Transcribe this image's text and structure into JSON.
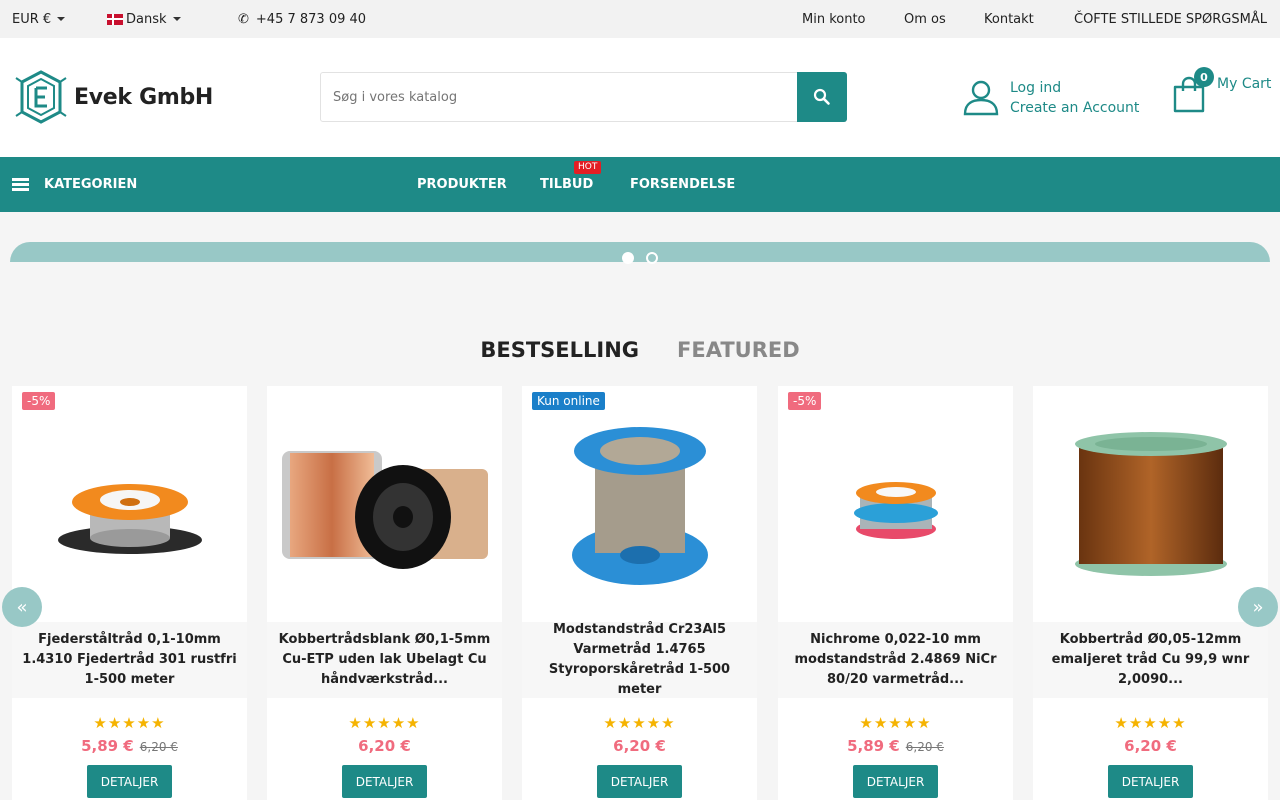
{
  "topbar": {
    "currency": "EUR €",
    "language": "Dansk",
    "phone_icon": "phone-icon",
    "phone": "+45 7 873 09 40",
    "links": [
      "Min konto",
      "Om os",
      "Kontakt",
      "ČOFTE STILLEDE SPØRGSMÅL"
    ]
  },
  "header": {
    "logo_text": "Evek GmbH",
    "search_placeholder": "Søg i vores katalog",
    "login": "Log ind",
    "create_account": "Create an Account",
    "cart_count": "0",
    "cart_label": "My Cart"
  },
  "nav": {
    "categories": "KATEGORIEN",
    "items": [
      "PRODUKTER",
      "TILBUD",
      "FORSENDELSE"
    ],
    "hot_badge": "HOT"
  },
  "tabs": [
    "BESTSELLING",
    "FEATURED"
  ],
  "products": [
    {
      "badge": "-5%",
      "title": "Fjederståltråd 0,1-10mm 1.4310 Fjedertråd 301 rustfri 1-500 meter",
      "price": "5,89 €",
      "old_price": "6,20 €",
      "stars": "★★★★★",
      "button": "DETALJER"
    },
    {
      "badge": "",
      "title": "Kobbertrådsblank Ø0,1-5mm Cu-ETP uden lak Ubelagt Cu håndværkstråd...",
      "price": "6,20 €",
      "old_price": "",
      "stars": "★★★★★",
      "button": "DETALJER"
    },
    {
      "badge": "Kun online",
      "title": "Modstandstråd Cr23Al5 Varmetråd 1.4765 Styroporskåretråd 1-500 meter",
      "price": "6,20 €",
      "old_price": "",
      "stars": "★★★★★",
      "button": "DETALJER"
    },
    {
      "badge": "-5%",
      "title": "Nichrome 0,022-10 mm modstandstråd 2.4869 NiCr 80/20 varmetråd...",
      "price": "5,89 €",
      "old_price": "6,20 €",
      "stars": "★★★★★",
      "button": "DETALJER"
    },
    {
      "badge": "",
      "title": "Kobbertråd Ø0,05-12mm emaljeret tråd Cu 99,9 wnr 2,0090...",
      "price": "6,20 €",
      "old_price": "",
      "stars": "★★★★★",
      "button": "DETALJER"
    }
  ],
  "arrows": {
    "prev": "«",
    "next": "»"
  },
  "colors": {
    "primary": "#1e8a87",
    "sale": "#f06b7e",
    "online_badge": "#1a7fc9",
    "hot": "#e31e24",
    "star": "#f5b301"
  }
}
